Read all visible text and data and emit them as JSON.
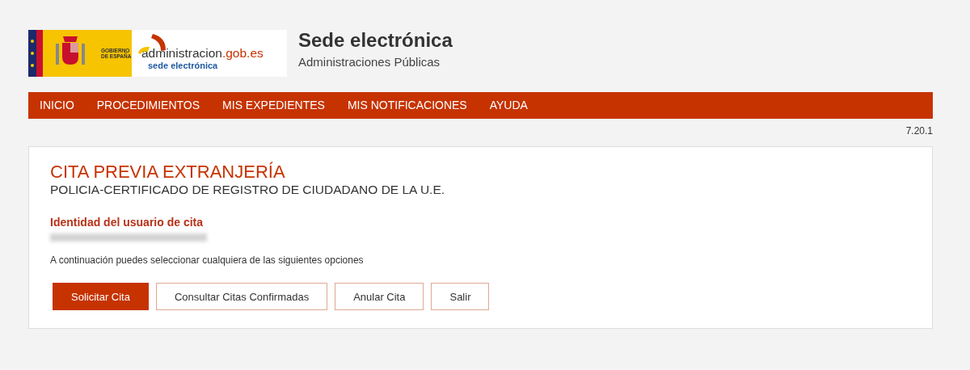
{
  "logo": {
    "government": "GOBIERNO\nDE ESPAÑA",
    "site_main": "administracion",
    "site_domain": ".gob.es",
    "site_sub": "sede electrónica"
  },
  "header": {
    "title": "Sede electrónica",
    "subtitle": "Administraciones Públicas"
  },
  "nav": [
    {
      "label": "INICIO"
    },
    {
      "label": "PROCEDIMIENTOS"
    },
    {
      "label": "MIS EXPEDIENTES"
    },
    {
      "label": "MIS NOTIFICACIONES"
    },
    {
      "label": "AYUDA"
    }
  ],
  "version": "7.20.1",
  "panel": {
    "title": "CITA PREVIA EXTRANJERÍA",
    "subtitle": "POLICIA-CERTIFICADO DE REGISTRO DE CIUDADANO DE LA U.E.",
    "identity_label": "Identidad del usuario de cita",
    "instructions": "A continuación puedes seleccionar cualquiera de las siguientes opciones"
  },
  "buttons": [
    {
      "label": "Solicitar Cita",
      "kind": "primary"
    },
    {
      "label": "Consultar Citas Confirmadas",
      "kind": "secondary"
    },
    {
      "label": "Anular Cita",
      "kind": "secondary"
    },
    {
      "label": "Salir",
      "kind": "secondary"
    }
  ]
}
